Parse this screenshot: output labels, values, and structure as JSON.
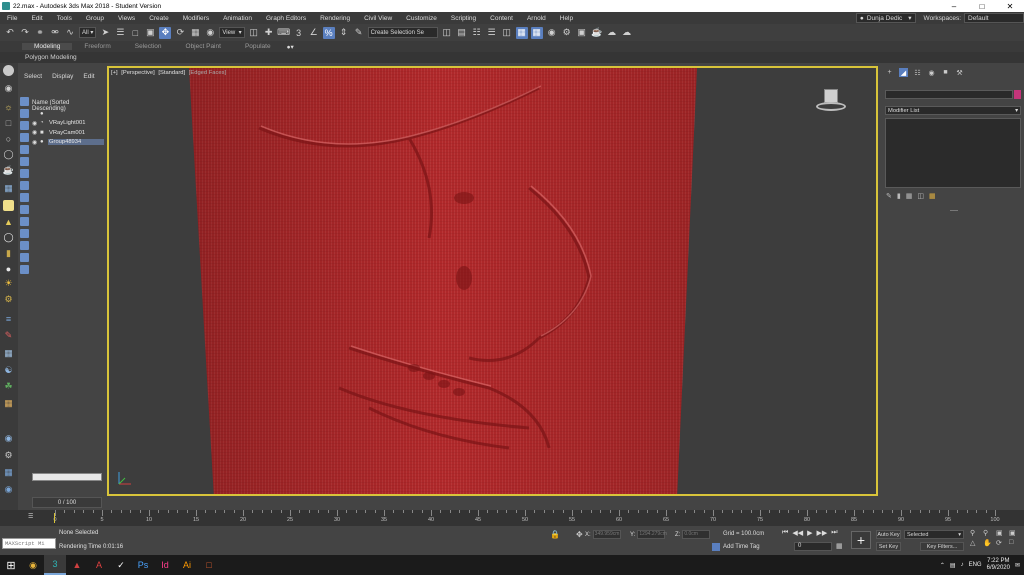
{
  "window": {
    "title": "22.max - Autodesk 3ds Max 2018 - Student Version",
    "controls": [
      "–",
      "□",
      "✕"
    ]
  },
  "menu": {
    "items": [
      "File",
      "Edit",
      "Tools",
      "Group",
      "Views",
      "Create",
      "Modifiers",
      "Animation",
      "Graph Editors",
      "Rendering",
      "Civil View",
      "Customize",
      "Scripting",
      "Content",
      "Arnold",
      "Help"
    ],
    "user": "Dunja Dedic",
    "workspace_label": "Workspaces:",
    "workspace_value": "Default"
  },
  "toolbar": {
    "selection_filter": "All",
    "ref_coord": "View",
    "named_selection": "Create Selection Se"
  },
  "ribbon": {
    "tabs": [
      "Modeling",
      "Freeform",
      "Selection",
      "Object Paint",
      "Populate"
    ],
    "sub_label": "Polygon Modeling"
  },
  "scene_explorer": {
    "tabs": [
      "Select",
      "Display",
      "Edit"
    ],
    "column_header": "Name (Sorted Descending)",
    "items": [
      {
        "name": "​",
        "icon": "sun-icon"
      },
      {
        "name": "VRayLight001",
        "icon": "light-icon"
      },
      {
        "name": "VRayCam001",
        "icon": "camera-icon"
      },
      {
        "name": "Group48934",
        "icon": "group-icon"
      }
    ]
  },
  "viewport": {
    "label_parts": [
      "[+]",
      "[Perspective]",
      "[Standard]",
      "[Edged Faces]"
    ],
    "relief_color": "#b52a2c",
    "border_color": "#d8c43a"
  },
  "command_panel": {
    "modifier_list": "Modifier List",
    "accent_color": "#c4357a"
  },
  "timeline": {
    "frame_counter": "0 / 100",
    "current_frame": 0,
    "total_frames": 100,
    "tick_labels": [
      "0",
      "5",
      "10",
      "15",
      "20",
      "25",
      "30",
      "35",
      "40",
      "45",
      "50",
      "55",
      "60",
      "65",
      "70",
      "75",
      "80",
      "85",
      "90",
      "95",
      "100"
    ]
  },
  "status": {
    "maxscript_placeholder": "MAXScript Mi",
    "selection": "None Selected",
    "render_time": "Rendering Time  0:01:16",
    "x_label": "X:",
    "x_value": "349.959cm",
    "y_label": "Y:",
    "y_value": "1294.279cm",
    "z_label": "Z:",
    "z_value": "0.0cm",
    "grid": "Grid = 100.0cm",
    "add_time_tag": "Add Time Tag",
    "frame_value": "0",
    "auto_key": "Auto Key",
    "set_key": "Set Key",
    "selected_dropdown": "Selected",
    "key_filters": "Key Filters..."
  },
  "taskbar": {
    "apps": [
      "windows-start-icon",
      "chrome-icon",
      "3dsmax-icon",
      "sketchup-icon",
      "autocad-icon",
      "vray-icon",
      "photoshop-icon",
      "indesign-icon",
      "illustrator-icon",
      "unknown-app-icon"
    ],
    "lang": "ENG",
    "time": "7:22 PM",
    "date": "6/9/2020"
  }
}
